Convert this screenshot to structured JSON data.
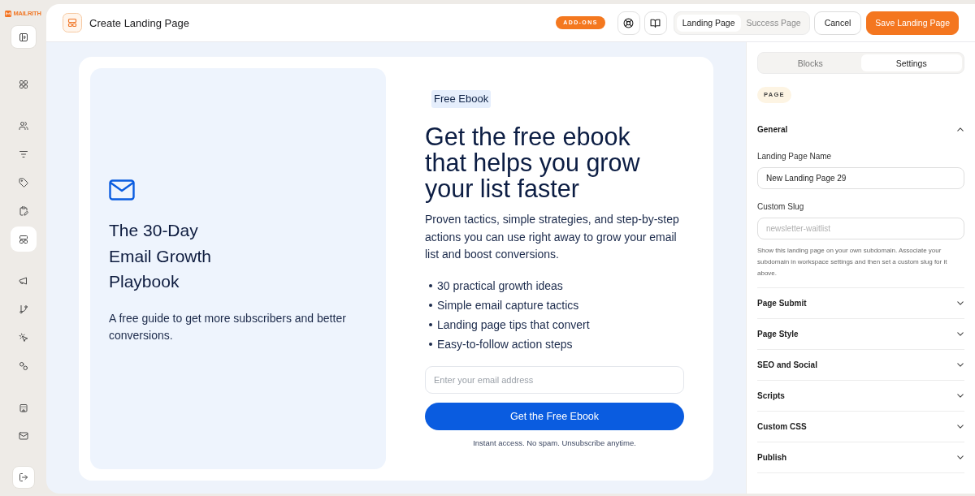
{
  "brand": {
    "name": "MAILRITH"
  },
  "sidebar": {
    "groups": [
      {
        "items": [
          {
            "selected": false
          }
        ]
      },
      {
        "items": [
          {
            "selected": false
          },
          {
            "selected": false
          },
          {
            "selected": false
          },
          {
            "selected": false
          },
          {
            "selected": true
          }
        ]
      },
      {
        "items": [
          {
            "selected": false
          },
          {
            "selected": false
          },
          {
            "selected": false
          },
          {
            "selected": false
          }
        ]
      },
      {
        "items": [
          {
            "selected": false
          },
          {
            "selected": false
          }
        ]
      }
    ]
  },
  "header": {
    "title": "Create Landing Page",
    "badge": "ADD-ONS",
    "view_tabs": [
      {
        "label": "Landing Page",
        "selected": true
      },
      {
        "label": "Success Page",
        "selected": false
      }
    ],
    "buttons": [
      {
        "label": "Cancel",
        "kind": "secondary"
      },
      {
        "label": "Save Landing Page",
        "kind": "primary"
      }
    ]
  },
  "preview": {
    "cover": {
      "title": "The 30-Day Email Growth Playbook",
      "subtitle": "A free guide to get more subscribers and better conversions."
    },
    "badge": "Free Ebook",
    "heading": "Get the free ebook that helps you grow your list faster",
    "intro": "Proven tactics, simple strategies, and step-by-step actions you can use right away to grow your email list and boost conversions.",
    "bullets": [
      "30 practical growth ideas",
      "Simple email capture tactics",
      "Landing page tips that convert",
      "Easy-to-follow action steps"
    ],
    "email_field": {
      "placeholder": "Enter your email address"
    },
    "submit_button": "Get the Free Ebook",
    "note": "Instant access. No spam. Unsubscribe anytime."
  },
  "settings": {
    "tabs": [
      {
        "label": "Blocks",
        "selected": false
      },
      {
        "label": "Settings",
        "selected": true
      }
    ],
    "section_label": "PAGE",
    "sections": [
      {
        "title": "General",
        "expanded": true,
        "fields": [
          {
            "label": "Landing Page Name",
            "value": "New Landing Page 29"
          },
          {
            "label": "Custom Slug",
            "placeholder": "newsletter-waitlist"
          }
        ],
        "help": "Show this landing page on your own subdomain. Associate your subdomain in workspace settings and then set a custom slug for it above."
      },
      {
        "title": "Page Submit",
        "expanded": false
      },
      {
        "title": "Page Style",
        "expanded": false
      },
      {
        "title": "SEO and Social",
        "expanded": false
      },
      {
        "title": "Scripts",
        "expanded": false
      },
      {
        "title": "Custom CSS",
        "expanded": false
      },
      {
        "title": "Publish",
        "expanded": false
      }
    ]
  }
}
